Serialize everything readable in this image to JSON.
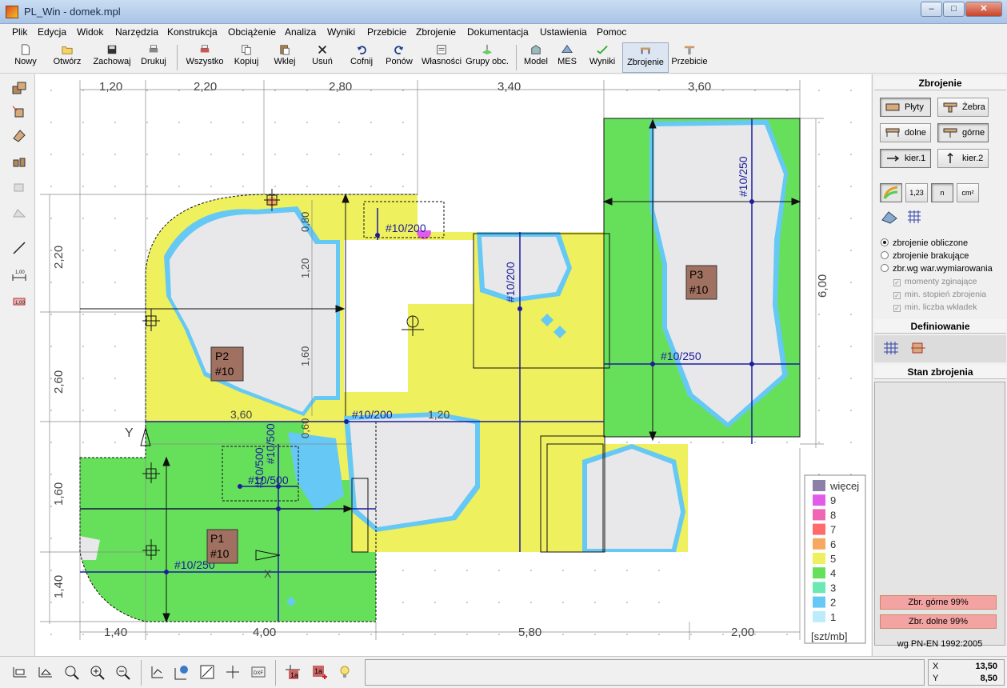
{
  "window": {
    "title": "PL_Win - domek.mpl",
    "min": "–",
    "max": "□",
    "close": "✕"
  },
  "menu": [
    "Plik",
    "Edycja",
    "Widok",
    "Narzędzia",
    "Konstrukcja",
    "Obciążenie",
    "Analiza",
    "Wyniki",
    "Przebicie",
    "Zbrojenie",
    "Dokumentacja",
    "Ustawienia",
    "Pomoc"
  ],
  "toolbar": [
    {
      "label": "Nowy",
      "icon": "new-file-icon"
    },
    {
      "label": "Otwórz",
      "icon": "open-folder-icon"
    },
    {
      "label": "Zachowaj",
      "icon": "save-disk-icon"
    },
    {
      "label": "Drukuj",
      "icon": "printer-icon"
    },
    {
      "label": "Wszystko",
      "icon": "print-all-icon"
    },
    {
      "label": "Kopiuj",
      "icon": "copy-icon"
    },
    {
      "label": "Wklej",
      "icon": "paste-icon"
    },
    {
      "label": "Usuń",
      "icon": "delete-icon"
    },
    {
      "label": "Cofnij",
      "icon": "undo-icon"
    },
    {
      "label": "Ponów",
      "icon": "redo-icon"
    },
    {
      "label": "Własności",
      "icon": "properties-icon"
    },
    {
      "label": "Grupy obc.",
      "icon": "load-groups-icon"
    },
    {
      "label": "Model",
      "icon": "model-icon"
    },
    {
      "label": "MES",
      "icon": "fem-mesh-icon"
    },
    {
      "label": "Wyniki",
      "icon": "results-icon"
    },
    {
      "label": "Zbrojenie",
      "icon": "reinforcement-icon"
    },
    {
      "label": "Przebicie",
      "icon": "punching-icon"
    }
  ],
  "right_panel": {
    "zbrojenie_title": "Zbrojenie",
    "plyty": "Płyty",
    "zebra": "Żebra",
    "dolne": "dolne",
    "gorne": "górne",
    "kier1": "kier.1",
    "kier2": "kier.2",
    "icon_123": "1,23",
    "icon_n": "n",
    "icon_cm2": "cm²",
    "radio": [
      "zbrojenie obliczone",
      "zbrojenie brakujące",
      "zbr.wg war.wymiarowania"
    ],
    "checks": [
      "momenty zginające",
      "min. stopień zbrojenia",
      "min. liczba wkładek"
    ],
    "definiowanie_title": "Definiowanie",
    "stan_title": "Stan zbrojenia",
    "zbr_gorne": "Zbr. górne 99%",
    "zbr_dolne": "Zbr. dolne 99%",
    "norm": "wg PN-EN 1992:2005"
  },
  "drawing": {
    "top_dims": [
      "1,20",
      "2,20",
      "2,80",
      "3,40",
      "3,60"
    ],
    "bottom_dims": [
      "1,40",
      "4,00",
      "5,80",
      "2,00"
    ],
    "left_dims": [
      "2,20",
      "2,60",
      "1,60",
      "1,40"
    ],
    "inner_dims": [
      "0,80",
      "1,20",
      "1,60",
      "3,60",
      "1,20",
      "0,60"
    ],
    "right_dim": "6,00",
    "axis_y": "Y",
    "axis_x": "X",
    "plates": [
      {
        "name": "P2",
        "bar": "#10"
      },
      {
        "name": "P1",
        "bar": "#10"
      },
      {
        "name": "P3",
        "bar": "#10"
      }
    ],
    "rebar_labels": [
      "#10/200",
      "#10/200",
      "#10/250",
      "#10/250",
      "#10/200",
      "#10/250",
      "#10/500",
      "#10/500",
      "#10/500"
    ],
    "legend": {
      "items": [
        {
          "label": "więcej",
          "color": "#8c7fa8"
        },
        {
          "label": "9",
          "color": "#e05ce8"
        },
        {
          "label": "8",
          "color": "#f066b4"
        },
        {
          "label": "7",
          "color": "#ff6a6a"
        },
        {
          "label": "6",
          "color": "#f7a860"
        },
        {
          "label": "5",
          "color": "#eef05e"
        },
        {
          "label": "4",
          "color": "#66e05a"
        },
        {
          "label": "3",
          "color": "#6ce8b4"
        },
        {
          "label": "2",
          "color": "#66c8f4"
        },
        {
          "label": "1",
          "color": "#bcecfc"
        }
      ],
      "unit": "[szt/mb]"
    }
  },
  "status": {
    "x_label": "X",
    "x_value": "13,50",
    "y_label": "Y",
    "y_value": "8,50"
  }
}
